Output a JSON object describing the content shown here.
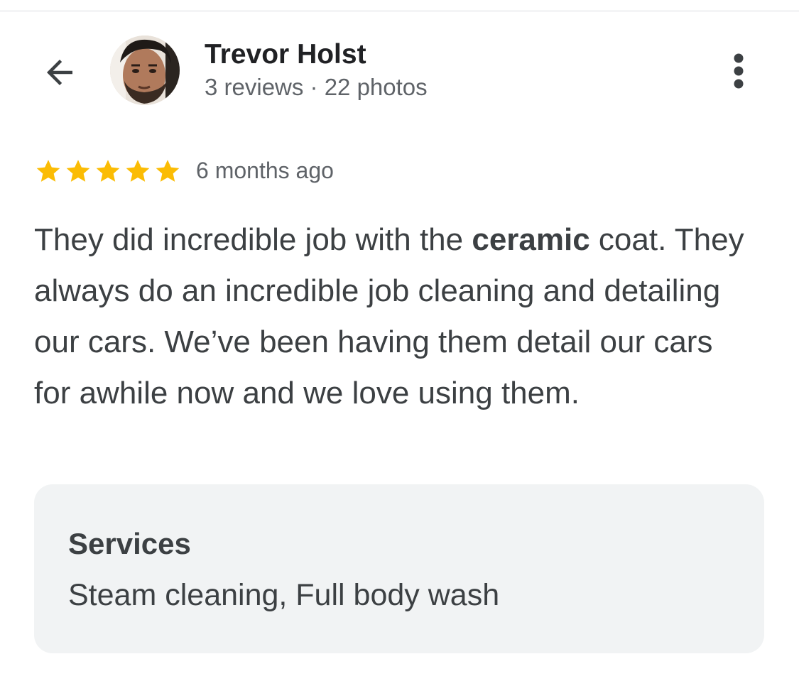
{
  "reviewer": {
    "name": "Trevor Holst",
    "meta": "3 reviews · 22 photos"
  },
  "rating": {
    "stars": 5,
    "max": 5,
    "color": "#fbbc04"
  },
  "timestamp": "6 months ago",
  "review": {
    "part1": "They did incredible job with the ",
    "highlight": "ceramic",
    "part2": " coat. They always do an incredible job cleaning and detailing our cars. We’ve been having them detail our cars for awhile now and we love using them."
  },
  "services": {
    "title": "Services",
    "list": "Steam cleaning, Full body wash"
  },
  "icons": {
    "back": "arrow-back-icon",
    "more": "more-vertical-icon",
    "star": "star-icon"
  },
  "colors": {
    "background": "#ffffff",
    "services_bg": "#f1f3f4",
    "name_text": "#202124",
    "secondary_text": "#5f6368",
    "body_text": "#3c4043"
  }
}
